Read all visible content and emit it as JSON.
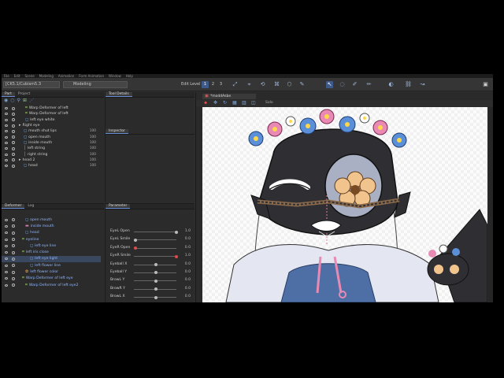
{
  "menu": [
    "File",
    "Edit",
    "Scene",
    "Modeling",
    "Animation",
    "Form Animation",
    "Window",
    "Help"
  ],
  "toolbar": {
    "file_name": "[CK5.1/Cubism5.3",
    "mode": "Modeling",
    "edit_level_label": "Edit Level",
    "level_1": "1",
    "level_2": "2",
    "level_3": "3"
  },
  "part_panel": {
    "tabs": [
      "Part",
      "Project"
    ],
    "rows": [
      {
        "icon": "warp-deformer-icon",
        "glyph": "⌗",
        "label": "Warp Deformer of left",
        "indent": 30,
        "value": ""
      },
      {
        "icon": "warp-deformer-icon",
        "glyph": "⌗",
        "label": "Warp Deformer of left",
        "indent": 30,
        "value": ""
      },
      {
        "icon": "artmesh-icon",
        "glyph": "◻",
        "label": "left eye white",
        "indent": 30,
        "value": ""
      },
      {
        "icon": "folder-icon",
        "glyph": "▸",
        "label": "Right eye",
        "indent": 22,
        "value": ""
      },
      {
        "icon": "artmesh-icon",
        "glyph": "◻",
        "label": "mouth shut lips",
        "indent": 28,
        "value": "100"
      },
      {
        "icon": "artmesh-icon",
        "glyph": "◻",
        "label": "open mouth",
        "indent": 28,
        "value": "100"
      },
      {
        "icon": "artmesh-icon",
        "glyph": "◻",
        "label": "inside mouth",
        "indent": 28,
        "value": "100"
      },
      {
        "icon": "artmesh-icon",
        "glyph": "│",
        "label": "left string",
        "indent": 28,
        "value": "100"
      },
      {
        "icon": "artmesh-icon",
        "glyph": "│",
        "label": "right string",
        "indent": 28,
        "value": "100"
      },
      {
        "icon": "folder-icon",
        "glyph": "▸",
        "label": "head 2",
        "indent": 22,
        "value": "100"
      },
      {
        "icon": "artmesh-icon",
        "glyph": "◻",
        "label": "head",
        "indent": 28,
        "value": "100"
      }
    ]
  },
  "tool_panel": {
    "tool_details_tab": "Tool Details",
    "inspector_tab": "Inspector"
  },
  "deformer_panel": {
    "tabs": [
      "Deformer",
      "Log"
    ],
    "rows": [
      {
        "glyph": "◻",
        "label": "open mouth",
        "indent": 30,
        "color": "#7db3f0",
        "selected": false
      },
      {
        "glyph": "▬",
        "label": "inside mouth",
        "indent": 30,
        "color": "#e27ab7",
        "selected": false
      },
      {
        "glyph": "◻",
        "label": "head",
        "indent": 30,
        "color": "#7db3f0",
        "selected": false
      },
      {
        "glyph": "⌗",
        "label": "eyeline",
        "indent": 26,
        "color": "#9ccc65",
        "selected": false
      },
      {
        "glyph": "◻",
        "label": "left eye line",
        "indent": 36,
        "color": "#7db3f0",
        "selected": false
      },
      {
        "glyph": "⌗",
        "label": "left iris close",
        "indent": 26,
        "color": "#9ccc65",
        "selected": false
      },
      {
        "glyph": "◻",
        "label": "left eye light",
        "indent": 36,
        "color": "#7db3f0",
        "selected": true
      },
      {
        "glyph": "◻",
        "label": "left flower line",
        "indent": 36,
        "color": "#7db3f0",
        "selected": false
      },
      {
        "glyph": "✿",
        "label": "left flower color",
        "indent": 30,
        "color": "#e8a24a",
        "selected": false
      },
      {
        "glyph": "⌗",
        "label": "Warp Deformer of left eye",
        "indent": 26,
        "color": "#9ccc65",
        "selected": false
      },
      {
        "glyph": "⌗",
        "label": "Warp Deformer of left eye2",
        "indent": 30,
        "color": "#9ccc65",
        "selected": false
      }
    ]
  },
  "param_panel": {
    "tab": "Parameter",
    "params": [
      {
        "name": "EyeL Open",
        "value": "1.0",
        "level": 1.0,
        "red": false
      },
      {
        "name": "EyeL Smile",
        "value": "0.0",
        "level": 0.0,
        "red": false
      },
      {
        "name": "EyeR Open",
        "value": "0.0",
        "level": 0.0,
        "red": true
      },
      {
        "name": "EyeR Smile",
        "value": "1.0",
        "level": 1.0,
        "red": true
      },
      {
        "name": "Eyeball X",
        "value": "0.0",
        "level": 0.5,
        "red": false
      },
      {
        "name": "Eyeball Y",
        "value": "0.0",
        "level": 0.5,
        "red": false
      },
      {
        "name": "BrowL Y",
        "value": "0.0",
        "level": 0.5,
        "red": false
      },
      {
        "name": "BrowR Y",
        "value": "0.0",
        "level": 0.5,
        "red": false
      },
      {
        "name": "BrowL X",
        "value": "0.0",
        "level": 0.5,
        "red": false
      }
    ]
  },
  "viewport": {
    "tab_label": "*moddAsbe",
    "solo_label": "Solo"
  },
  "colors": {
    "accent": "#3d5a8a",
    "flower_blue": "#5b8fd8",
    "flower_pink": "#e88ab4",
    "flower_center": "#ffd84a",
    "face": "#2f2f33",
    "peach_flower": "#f2c48d",
    "shirt_blue": "#4d6fa6"
  }
}
